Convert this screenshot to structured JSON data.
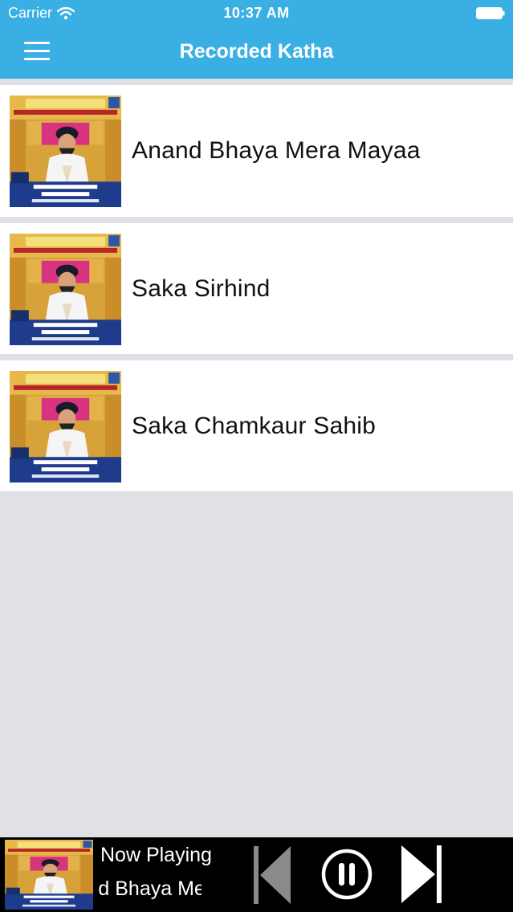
{
  "status_bar": {
    "carrier": "Carrier",
    "time": "10:37 AM"
  },
  "nav": {
    "title": "Recorded Katha",
    "menu_icon": "hamburger-icon"
  },
  "colors": {
    "accent": "#3aafe3",
    "background": "#e0e1e6",
    "player_bg": "#000000"
  },
  "list": {
    "items": [
      {
        "title": "Anand Bhaya Mera Mayaa"
      },
      {
        "title": "Saka Sirhind"
      },
      {
        "title": "Saka Chamkaur Sahib"
      }
    ]
  },
  "player": {
    "label": "Now Playing",
    "track": "Anand Bhaya Mera Mayaa",
    "track_visible": "ya Mera Ma",
    "prev_icon": "previous-track-icon",
    "pause_icon": "pause-icon",
    "next_icon": "next-track-icon"
  }
}
